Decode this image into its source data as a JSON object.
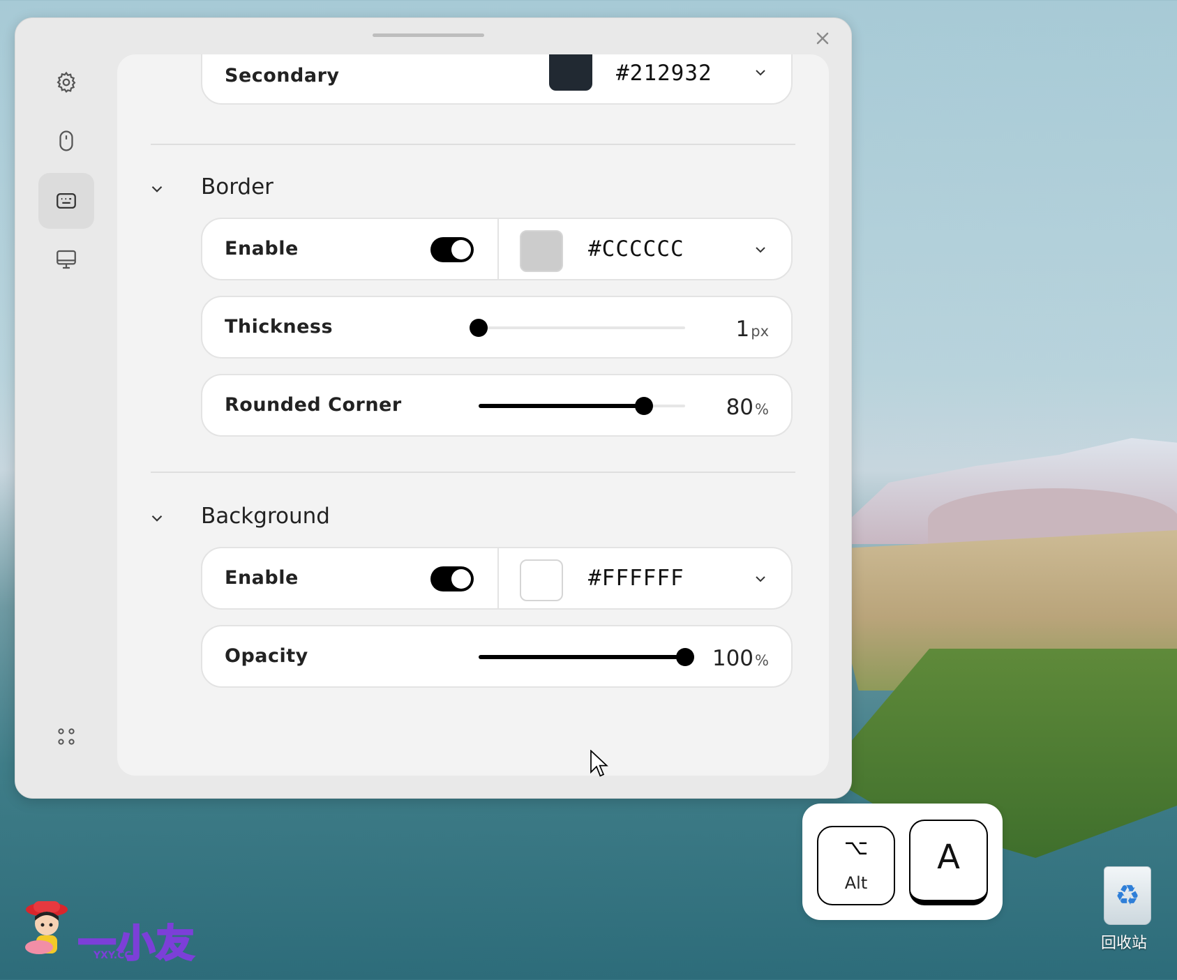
{
  "colors": {
    "accent": "#000000",
    "secondary_swatch": "#212932",
    "border_swatch": "#CCCCCC",
    "background_swatch": "#FFFFFF"
  },
  "sidebar": {
    "items": [
      {
        "icon": "gear-icon"
      },
      {
        "icon": "mouse-icon"
      },
      {
        "icon": "keyboard-icon",
        "active": true
      },
      {
        "icon": "monitor-icon"
      }
    ],
    "bottom_icon": "apps-grid-icon"
  },
  "secondary_row": {
    "label": "Secondary",
    "hex": "#212932"
  },
  "border": {
    "title": "Border",
    "enable_label": "Enable",
    "enabled": true,
    "hex": "#CCCCCC",
    "thickness": {
      "label": "Thickness",
      "value": "1",
      "unit": "px",
      "fraction": 0.0
    },
    "rounded": {
      "label": "Rounded Corner",
      "value": "80",
      "unit": "%",
      "fraction": 0.8
    }
  },
  "background": {
    "title": "Background",
    "enable_label": "Enable",
    "enabled": true,
    "hex": "#FFFFFF",
    "opacity": {
      "label": "Opacity",
      "value": "100",
      "unit": "%",
      "fraction": 1.0
    }
  },
  "keystroke": {
    "alt_symbol": "⌥",
    "alt_label": "Alt",
    "key_label": "A"
  },
  "desktop": {
    "recycle_bin_label": "回收站",
    "watermark_text": "一小友",
    "watermark_sub": "YXY.CC"
  }
}
